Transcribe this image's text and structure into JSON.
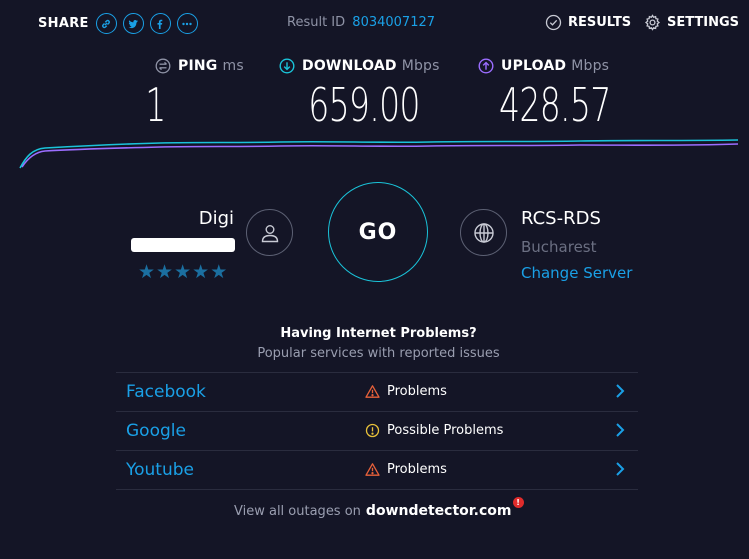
{
  "topbar": {
    "share_label": "SHARE",
    "share_icons": [
      "link-icon",
      "twitter-icon",
      "facebook-icon",
      "more-icon"
    ],
    "result_id_label": "Result ID",
    "result_id_value": "8034007127",
    "results_label": "RESULTS",
    "settings_label": "SETTINGS"
  },
  "metrics": {
    "ping": {
      "label": "PING",
      "unit": "ms",
      "value": "1"
    },
    "download": {
      "label": "DOWNLOAD",
      "unit": "Mbps",
      "value": "659.00"
    },
    "upload": {
      "label": "UPLOAD",
      "unit": "Mbps",
      "value": "428.57"
    }
  },
  "isp": {
    "name": "Digi",
    "rating_stars": 5
  },
  "go_label": "GO",
  "server": {
    "name": "RCS-RDS",
    "location": "Bucharest",
    "change_label": "Change Server"
  },
  "problems": {
    "title": "Having Internet Problems?",
    "subtitle": "Popular services with reported issues",
    "rows": [
      {
        "service": "Facebook",
        "status": "Problems",
        "status_icon": "warning-triangle-icon"
      },
      {
        "service": "Google",
        "status": "Possible Problems",
        "status_icon": "info-circle-icon"
      },
      {
        "service": "Youtube",
        "status": "Problems",
        "status_icon": "warning-triangle-icon"
      }
    ]
  },
  "footer": {
    "text": "View all outages on",
    "brand": "downdetector.com",
    "brand_badge": "!"
  },
  "colors": {
    "background": "#141526",
    "accent_blue": "#1aa0e6",
    "accent_cyan": "#1ac3d9",
    "upload_purple": "#9b6dff",
    "warning_red": "#e8613a",
    "info_yellow": "#e8c13a"
  }
}
